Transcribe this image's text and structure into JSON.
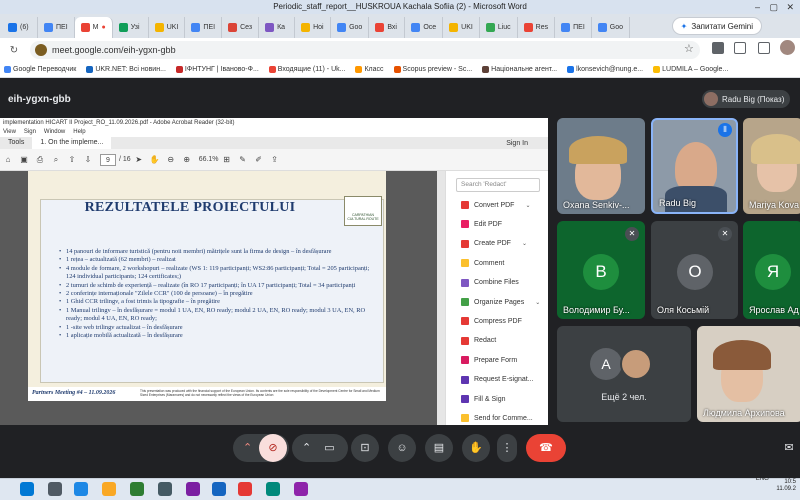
{
  "word_title": "Periodic_staff_report__HUSKROUA Kachala Sofiia (2)  -  Microsoft Word",
  "browser": {
    "tabs": [
      {
        "label": "(6)",
        "color": "#1a73e8"
      },
      {
        "label": "ПЕІ",
        "color": "#4285f4"
      },
      {
        "label": "М",
        "color": "#ea4335",
        "active": true
      },
      {
        "label": "Узі",
        "color": "#0f9d58"
      },
      {
        "label": "UKI",
        "color": "#f4b400"
      },
      {
        "label": "ПЕІ",
        "color": "#4285f4"
      },
      {
        "label": "Сез",
        "color": "#db4437"
      },
      {
        "label": "Ка",
        "color": "#7e57c2"
      },
      {
        "label": "Ноі",
        "color": "#f4b400"
      },
      {
        "label": "Goo",
        "color": "#4285f4"
      },
      {
        "label": "Вхі",
        "color": "#ea4335"
      },
      {
        "label": "Осе",
        "color": "#4285f4"
      },
      {
        "label": "UKI",
        "color": "#f4b400"
      },
      {
        "label": "Liuc",
        "color": "#34a853"
      },
      {
        "label": "Res",
        "color": "#ea4335"
      },
      {
        "label": "ПЕІ",
        "color": "#4285f4"
      },
      {
        "label": "Goo",
        "color": "#4285f4"
      }
    ],
    "gemini_label": "Запитати Gemini",
    "url": "meet.google.com/eih-ygxn-gbb",
    "bookmarks": [
      {
        "label": "Google Переводчик",
        "color": "#4285f4"
      },
      {
        "label": "UKR.NET: Всі новин...",
        "color": "#1565c0"
      },
      {
        "label": "ІФНТУНГ | Іваново-Ф...",
        "color": "#c62828"
      },
      {
        "label": "Входящие (11) - Uk...",
        "color": "#ea4335"
      },
      {
        "label": "Класс",
        "color": "#ff9800"
      },
      {
        "label": "Scopus preview - Sc...",
        "color": "#e65100"
      },
      {
        "label": "Національне агент...",
        "color": "#5d4037"
      },
      {
        "label": "lkonsevich@nung.e...",
        "color": "#1a73e8"
      },
      {
        "label": "LUDMILA – Google...",
        "color": "#fbbc04"
      }
    ]
  },
  "meet": {
    "meeting_code": "eih-ygxn-gbb",
    "presenter_label": "Radu Big (Показ)",
    "participants": [
      {
        "name": "Oxana Senkiv-...",
        "type": "video"
      },
      {
        "name": "Radu Big",
        "type": "video",
        "speaking": true
      },
      {
        "name": "Mariya Kova",
        "type": "video"
      },
      {
        "name": "Володимир Бу...",
        "initial": "В",
        "color": "#1e8e3e"
      },
      {
        "name": "Оля Косьмій",
        "initial": "О",
        "color": "#5f6368"
      },
      {
        "name": "Ярослав Ад",
        "initial": "Я",
        "color": "#1e8e3e"
      },
      {
        "name": "Людмила Архипова",
        "type": "video"
      }
    ],
    "others": {
      "label": "Ещё 2 чел.",
      "initial": "A"
    },
    "controls": {
      "hand": "✋",
      "end": "☎"
    }
  },
  "acrobat": {
    "title": "implementation HICART II Project_RO_11.09.2026.pdf - Adobe Acrobat Reader (32-bit)",
    "menu": [
      "View",
      "Sign",
      "Window",
      "Help"
    ],
    "tabs": {
      "tools": "Tools",
      "document": "1. On the impleme...",
      "sign_in": "Sign In"
    },
    "page_current": "9",
    "page_total": "/ 16",
    "zoom": "66.1%",
    "tools_search_placeholder": "Search 'Redact'",
    "tools": [
      {
        "label": "Convert PDF",
        "color": "#e53935",
        "chev": true
      },
      {
        "label": "Edit PDF",
        "color": "#e91e63"
      },
      {
        "label": "Create PDF",
        "color": "#e53935",
        "chev": true
      },
      {
        "label": "Comment",
        "color": "#fbc02d"
      },
      {
        "label": "Combine Files",
        "color": "#7e57c2"
      },
      {
        "label": "Organize Pages",
        "color": "#43a047",
        "chev": true
      },
      {
        "label": "Compress PDF",
        "color": "#e53935"
      },
      {
        "label": "Redact",
        "color": "#e53935"
      },
      {
        "label": "Prepare Form",
        "color": "#d81b60"
      },
      {
        "label": "Request E-signat...",
        "color": "#5e35b1"
      },
      {
        "label": "Fill & Sign",
        "color": "#5e35b1"
      },
      {
        "label": "Send for Comme...",
        "color": "#fbc02d"
      }
    ]
  },
  "slide": {
    "title": "REZULTATELE PROIECTULUI",
    "logo_text": "CARPATHIAN CULTURAL ROUTE",
    "bullets": [
      "14 panouri de informare turistică (pentru noii membri) mătrițele sunt la firma de design – în desfășurare",
      "1 rețea – actualizată (62 membri) – realizat",
      "4 module de formare, 2 workshopuri – realizate (WS 1: 119 participanți; WS2:86 participanți; Total = 205 participanți; 124 individual participants; 124 certificates;)",
      "2 turnuri de schimb de experiență – realizate (în RO 17 participanți; în UA 17 participanți; Total = 34 participanți",
      "2 conferințe internaționale \"Zilele CCR\" (100 de persoane) – în pregătire",
      "1 Ghid CCR trilingv, a fost trimis la tipografie – în pregătire",
      "1 Manual trilingv – în desfășurare = modul 1 UA, EN, RO ready; modul 2 UA, EN, RO ready; modul 3 UA, EN, RO ready; modul 4 UA, EN, RO ready;",
      "1 -site web trilingv actualizat – în desfășurare",
      "1 aplicație mobilă actualizată – în desfășurare"
    ],
    "footer": "Partners  Meeting #4 – 11.09.2026",
    "footer_note": "This presentation was produced with the financial support of the European Union. Its contents are the sole responsibility of the Development Centre for Small and Medium Sized Enterprises (Maramures) and do not necessarily reflect the views of the European Union"
  },
  "taskbar": {
    "lang": "ENG",
    "time": "10:5",
    "date": "11.09.2"
  }
}
